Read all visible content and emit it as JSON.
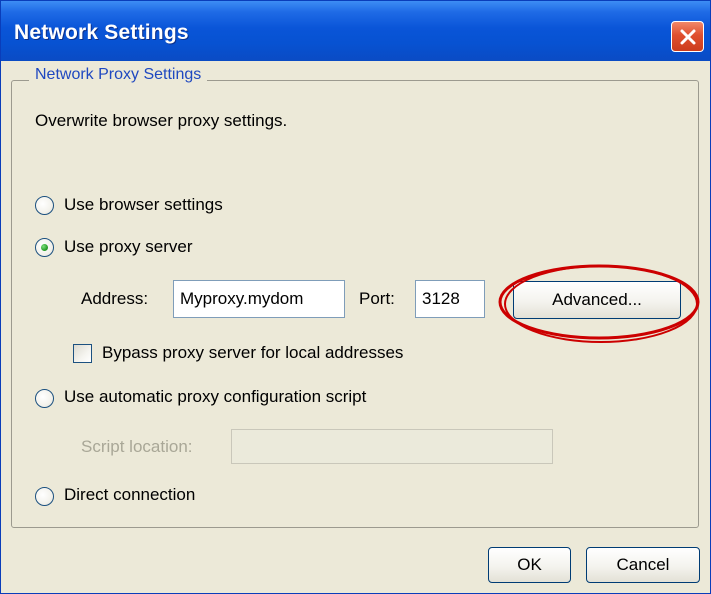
{
  "window": {
    "title": "Network Settings"
  },
  "group": {
    "legend": "Network Proxy Settings",
    "description": "Overwrite browser proxy settings."
  },
  "options": {
    "browser": {
      "label": "Use browser settings",
      "selected": false
    },
    "proxy": {
      "label": "Use proxy server",
      "selected": true
    },
    "auto": {
      "label": "Use automatic proxy configuration script",
      "selected": false
    },
    "direct": {
      "label": "Direct connection",
      "selected": false
    }
  },
  "proxy_fields": {
    "address_label": "Address:",
    "address_value": "Myproxy.mydom",
    "port_label": "Port:",
    "port_value": "3128",
    "advanced_label": "Advanced...",
    "bypass_label": "Bypass proxy server for local addresses",
    "bypass_checked": false
  },
  "auto_fields": {
    "script_label": "Script location:",
    "script_value": ""
  },
  "footer": {
    "ok_label": "OK",
    "cancel_label": "Cancel"
  },
  "colors": {
    "titlebar": "#0a55d8",
    "legend_text": "#1f48c0",
    "highlight_ellipse": "#cc0000",
    "close_button": "#e0502f"
  },
  "icons": {
    "close": "close-icon"
  }
}
